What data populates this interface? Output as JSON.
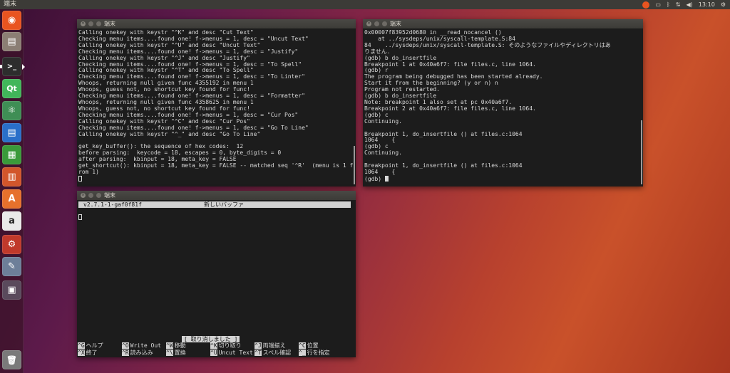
{
  "top_panel": {
    "app_name": "端末",
    "clock": "13:10",
    "tray_icons": [
      "ubuntu-update-icon",
      "keyboard-icon",
      "bluetooth-icon",
      "network-icon",
      "volume-icon",
      "clock",
      "power-gear-icon"
    ],
    "tray_glyphs": {
      "keyboard": "▭",
      "bluetooth": "ᛒ",
      "network": "⇅",
      "volume": "◀)",
      "power": "⚙"
    }
  },
  "launcher": {
    "items": [
      {
        "name": "dash-home",
        "glyph": "◉",
        "color": "#e95420"
      },
      {
        "name": "files",
        "glyph": "▤",
        "color": "#8b7e74"
      },
      {
        "name": "terminal",
        "glyph": ">_",
        "color": "#2d2d2d"
      },
      {
        "name": "qt-creator",
        "glyph": "Qt",
        "color": "#41b65a"
      },
      {
        "name": "atom",
        "glyph": "⚛",
        "color": "#3f8e55"
      },
      {
        "name": "writer",
        "glyph": "▤",
        "color": "#2a6fc9"
      },
      {
        "name": "calc",
        "glyph": "▦",
        "color": "#3a9a3a"
      },
      {
        "name": "impress",
        "glyph": "▥",
        "color": "#d2562b"
      },
      {
        "name": "software-center",
        "glyph": "A",
        "color": "#e6712c"
      },
      {
        "name": "amazon",
        "glyph": "a",
        "color": "#e9e9e9"
      },
      {
        "name": "system-settings",
        "glyph": "⚙",
        "color": "#c0392b"
      },
      {
        "name": "disk-tool",
        "glyph": "✎",
        "color": "#6d7f99"
      },
      {
        "name": "workspace-switcher",
        "glyph": "▣",
        "color": "#5a4a5c"
      },
      {
        "name": "trash",
        "glyph": "🗑",
        "color": "#7a7a7a"
      }
    ]
  },
  "window1": {
    "title": "端末",
    "lines": [
      "Calling onekey with keystr \"^K\" and desc \"Cut Text\"",
      "Checking menu items....found one! f->menus = 1, desc = \"Uncut Text\"",
      "Calling onekey with keystr \"^U\" and desc \"Uncut Text\"",
      "Checking menu items....found one! f->menus = 1, desc = \"Justify\"",
      "Calling onekey with keystr \"^J\" and desc \"Justify\"",
      "Checking menu items....found one! f->menus = 1, desc = \"To Spell\"",
      "Calling onekey with keystr \"^T\" and desc \"To Spell\"",
      "Checking menu items....found one! f->menus = 1, desc = \"To Linter\"",
      "Whoops, returning null given func 4355192 in menu 1",
      "Whoops, guess not, no shortcut key found for func!",
      "Checking menu items....found one! f->menus = 1, desc = \"Formatter\"",
      "Whoops, returning null given func 4358625 in menu 1",
      "Whoops, guess not, no shortcut key found for func!",
      "Checking menu items....found one! f->menus = 1, desc = \"Cur Pos\"",
      "Calling onekey with keystr \"^C\" and desc \"Cur Pos\"",
      "Checking menu items....found one! f->menus = 1, desc = \"Go To Line\"",
      "Calling onekey with keystr \"^_\" and desc \"Go To Line\"",
      "",
      "get_key_buffer(): the sequence of hex codes:  12",
      "before parsing:  keycode = 18, escapes = 0, byte_digits = 0",
      "after parsing:  kbinput = 18, meta_key = FALSE",
      "get_shortcut(): kbinput = 18, meta_key = FALSE -- matched seq '^R'  (menu is 1 f",
      "rom 1)"
    ]
  },
  "window2": {
    "title": "端末",
    "lines": [
      "0x00007f83952d0680 in __read_nocancel ()",
      "    at ../sysdeps/unix/syscall-template.S:84",
      "84\t../sysdeps/unix/syscall-template.S: そのようなファイルやディレクトリはあ",
      "りません.",
      "(gdb) b do_insertfile",
      "Breakpoint 1 at 0x40a6f7: file files.c, line 1064.",
      "(gdb) r",
      "The program being debugged has been started already.",
      "Start it from the beginning? (y or n) n",
      "Program not restarted.",
      "(gdb) b do_insertfile",
      "Note: breakpoint 1 also set at pc 0x40a6f7.",
      "Breakpoint 2 at 0x40a6f7: file files.c, line 1064.",
      "(gdb) c",
      "Continuing.",
      "",
      "Breakpoint 1, do_insertfile () at files.c:1064",
      "1064\t{",
      "(gdb) c",
      "Continuing.",
      "",
      "Breakpoint 1, do_insertfile () at files.c:1064",
      "1064\t{"
    ],
    "prompt": "(gdb) "
  },
  "window3": {
    "title": "端末",
    "nano_version": "v2.7.1-1-gaf0f81f",
    "buffer_name": "新しいバッファ",
    "status_message": "[ 取り消しました ]",
    "shortcuts_row1": [
      {
        "key": "^G",
        "label": "ヘルプ"
      },
      {
        "key": "^O",
        "label": "Write Out"
      },
      {
        "key": "^W",
        "label": "移動"
      },
      {
        "key": "^K",
        "label": "切り取り"
      },
      {
        "key": "^J",
        "label": "両端揃え"
      },
      {
        "key": "^C",
        "label": "位置"
      }
    ],
    "shortcuts_row2": [
      {
        "key": "^X",
        "label": "終了"
      },
      {
        "key": "^R",
        "label": "読み込み"
      },
      {
        "key": "^\\",
        "label": "置換"
      },
      {
        "key": "^U",
        "label": "Uncut Text"
      },
      {
        "key": "^T",
        "label": "スペル確認"
      },
      {
        "key": "^_",
        "label": "行を指定"
      }
    ]
  }
}
